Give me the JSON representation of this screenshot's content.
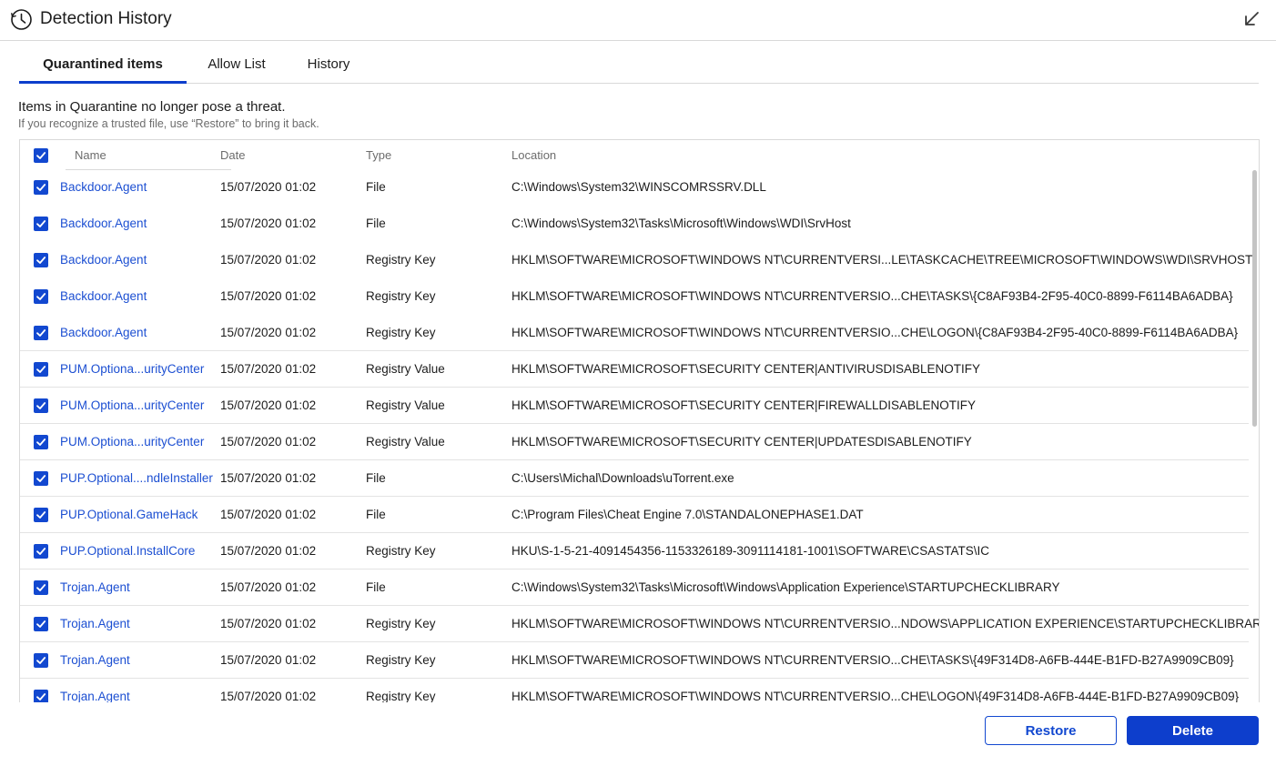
{
  "window": {
    "title": "Detection History",
    "icon": "clock-icon",
    "collapse_icon": "arrow-down-left-icon"
  },
  "tabs": [
    {
      "label": "Quarantined items",
      "active": true
    },
    {
      "label": "Allow List",
      "active": false
    },
    {
      "label": "History",
      "active": false
    }
  ],
  "info": {
    "main": "Items in Quarantine no longer pose a threat.",
    "sub": "If you recognize a trusted file, use “Restore” to bring it back."
  },
  "table": {
    "columns": {
      "name": "Name",
      "date": "Date",
      "type": "Type",
      "location": "Location"
    },
    "select_all_checked": true,
    "rows": [
      {
        "checked": true,
        "name": "Backdoor.Agent",
        "date": "15/07/2020 01:02",
        "type": "File",
        "location": "C:\\Windows\\System32\\WINSCOMRSSRV.DLL"
      },
      {
        "checked": true,
        "name": "Backdoor.Agent",
        "date": "15/07/2020 01:02",
        "type": "File",
        "location": "C:\\Windows\\System32\\Tasks\\Microsoft\\Windows\\WDI\\SrvHost"
      },
      {
        "checked": true,
        "name": "Backdoor.Agent",
        "date": "15/07/2020 01:02",
        "type": "Registry Key",
        "location": "HKLM\\SOFTWARE\\MICROSOFT\\WINDOWS NT\\CURRENTVERSI...LE\\TASKCACHE\\TREE\\MICROSOFT\\WINDOWS\\WDI\\SRVHOST"
      },
      {
        "checked": true,
        "name": "Backdoor.Agent",
        "date": "15/07/2020 01:02",
        "type": "Registry Key",
        "location": "HKLM\\SOFTWARE\\MICROSOFT\\WINDOWS NT\\CURRENTVERSIO...CHE\\TASKS\\{C8AF93B4-2F95-40C0-8899-F6114BA6ADBA}"
      },
      {
        "checked": true,
        "name": "Backdoor.Agent",
        "date": "15/07/2020 01:02",
        "type": "Registry Key",
        "location": "HKLM\\SOFTWARE\\MICROSOFT\\WINDOWS NT\\CURRENTVERSIO...CHE\\LOGON\\{C8AF93B4-2F95-40C0-8899-F6114BA6ADBA}"
      },
      {
        "checked": true,
        "name": "PUM.Optiona...urityCenter",
        "date": "15/07/2020 01:02",
        "type": "Registry Value",
        "location": "HKLM\\SOFTWARE\\MICROSOFT\\SECURITY CENTER|ANTIVIRUSDISABLENOTIFY"
      },
      {
        "checked": true,
        "name": "PUM.Optiona...urityCenter",
        "date": "15/07/2020 01:02",
        "type": "Registry Value",
        "location": "HKLM\\SOFTWARE\\MICROSOFT\\SECURITY CENTER|FIREWALLDISABLENOTIFY"
      },
      {
        "checked": true,
        "name": "PUM.Optiona...urityCenter",
        "date": "15/07/2020 01:02",
        "type": "Registry Value",
        "location": "HKLM\\SOFTWARE\\MICROSOFT\\SECURITY CENTER|UPDATESDISABLENOTIFY"
      },
      {
        "checked": true,
        "name": "PUP.Optional....ndleInstaller",
        "date": "15/07/2020 01:02",
        "type": "File",
        "location": "C:\\Users\\Michal\\Downloads\\uTorrent.exe"
      },
      {
        "checked": true,
        "name": "PUP.Optional.GameHack",
        "date": "15/07/2020 01:02",
        "type": "File",
        "location": "C:\\Program Files\\Cheat Engine 7.0\\STANDALONEPHASE1.DAT"
      },
      {
        "checked": true,
        "name": "PUP.Optional.InstallCore",
        "date": "15/07/2020 01:02",
        "type": "Registry Key",
        "location": "HKU\\S-1-5-21-4091454356-1153326189-3091114181-1001\\SOFTWARE\\CSASTATS\\IC"
      },
      {
        "checked": true,
        "name": "Trojan.Agent",
        "date": "15/07/2020 01:02",
        "type": "File",
        "location": "C:\\Windows\\System32\\Tasks\\Microsoft\\Windows\\Application Experience\\STARTUPCHECKLIBRARY"
      },
      {
        "checked": true,
        "name": "Trojan.Agent",
        "date": "15/07/2020 01:02",
        "type": "Registry Key",
        "location": "HKLM\\SOFTWARE\\MICROSOFT\\WINDOWS NT\\CURRENTVERSIO...NDOWS\\APPLICATION EXPERIENCE\\STARTUPCHECKLIBRARY"
      },
      {
        "checked": true,
        "name": "Trojan.Agent",
        "date": "15/07/2020 01:02",
        "type": "Registry Key",
        "location": "HKLM\\SOFTWARE\\MICROSOFT\\WINDOWS NT\\CURRENTVERSIO...CHE\\TASKS\\{49F314D8-A6FB-444E-B1FD-B27A9909CB09}"
      },
      {
        "checked": true,
        "name": "Trojan.Agent",
        "date": "15/07/2020 01:02",
        "type": "Registry Key",
        "location": "HKLM\\SOFTWARE\\MICROSOFT\\WINDOWS NT\\CURRENTVERSIO...CHE\\LOGON\\{49F314D8-A6FB-444E-B1FD-B27A9909CB09}"
      }
    ]
  },
  "actions": {
    "restore_label": "Restore",
    "delete_label": "Delete"
  },
  "colors": {
    "accent": "#0D3ECC",
    "link": "#1C4FD2",
    "checkbox": "#1248D0"
  }
}
